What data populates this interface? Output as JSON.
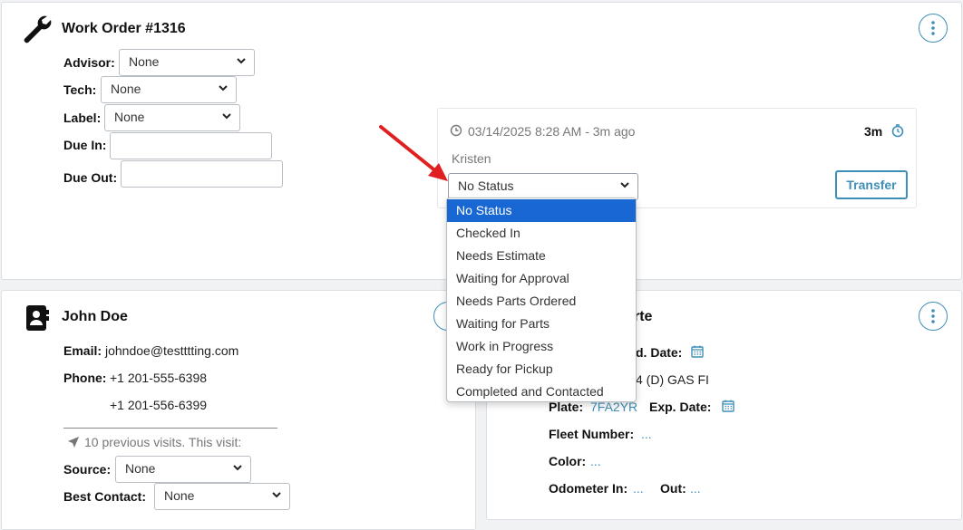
{
  "work_order": {
    "title": "Work Order #1316",
    "advisor_label": "Advisor:",
    "advisor_value": "None",
    "tech_label": "Tech:",
    "tech_value": "None",
    "label_label": "Label:",
    "label_value": "None",
    "due_in_label": "Due In:",
    "due_out_label": "Due Out:"
  },
  "status_panel": {
    "timestamp": "03/14/2025 8:28 AM - 3m ago",
    "elapsed": "3m",
    "user": "Kristen",
    "status_value": "No Status",
    "transfer_label": "Transfer"
  },
  "status_options": [
    "No Status",
    "Checked In",
    "Needs Estimate",
    "Waiting for Approval",
    "Needs Parts Ordered",
    "Waiting for Parts",
    "Work in Progress",
    "Ready for Pickup",
    "Completed and Contacted"
  ],
  "customer": {
    "name": "John Doe",
    "email_label": "Email:",
    "email": "johndoe@testttting.com",
    "phone_label": "Phone:",
    "phone1": "+1 201-555-6398",
    "phone2": "+1 201-556-6399",
    "visits_text": "10 previous visits. This visit:",
    "source_label": "Source:",
    "source_value": "None",
    "best_contact_label": "Best Contact:",
    "best_contact_value": "None"
  },
  "vehicle": {
    "title_fragment": "rte",
    "date_label_fragment": "d. Date:",
    "engine_fragment": "4 (D) GAS FI",
    "plate_label": "Plate:",
    "plate_value": "7FA2YR",
    "exp_date_label": "Exp. Date:",
    "fleet_label": "Fleet Number:",
    "fleet_value": "...",
    "color_label": "Color:",
    "color_value": "...",
    "odometer_in_label": "Odometer In:",
    "odometer_in_value": "...",
    "out_label": "Out:",
    "out_value": "..."
  },
  "colors": {
    "accent": "#3f8fb8",
    "selected_option": "#1967d2",
    "arrow": "#e02020"
  }
}
